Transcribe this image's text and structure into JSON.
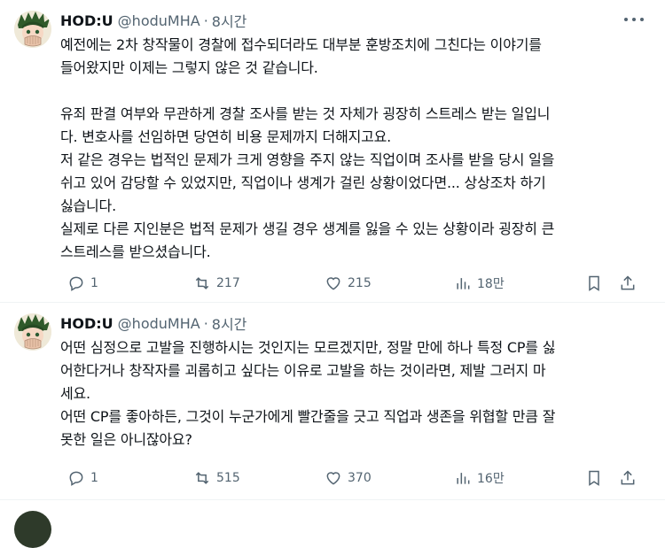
{
  "tweets": [
    {
      "name": "HOD:U",
      "handle": "@hoduMHA",
      "dot": "·",
      "time": "8시간",
      "lines": [
        "예전에는 2차 창작물이 경찰에 접수되더라도 대부분 훈방조치에 그친다는 이야기를",
        "들어왔지만 이제는 그렇지 않은 것 같습니다.",
        "",
        "유죄 판결 여부와 무관하게 경찰 조사를 받는 것 자체가 굉장히 스트레스 받는 일입니",
        "다. 변호사를 선임하면 당연히 비용 문제까지 더해지고요.",
        "저 같은 경우는 법적인 문제가 크게 영향을 주지 않는 직업이며 조사를 받을 당시 일을",
        "쉬고 있어 감당할 수 있었지만, 직업이나 생계가 걸린 상황이었다면... 상상조차 하기",
        "싫습니다.",
        "실제로 다른 지인분은 법적 문제가 생길 경우 생계를 잃을 수 있는 상황이라 굉장히 큰",
        "스트레스를 받으셨습니다."
      ],
      "replies": "1",
      "retweets": "217",
      "likes": "215",
      "views": "18만"
    },
    {
      "name": "HOD:U",
      "handle": "@hoduMHA",
      "dot": "·",
      "time": "8시간",
      "lines": [
        "어떤 심정으로 고발을 진행하시는 것인지는 모르겠지만, 정말 만에 하나 특정 CP를 싫",
        "어한다거나 창작자를 괴롭히고 싶다는 이유로 고발을 하는 것이라면, 제발 그러지 마",
        "세요.",
        "어떤 CP를 좋아하든, 그것이 누군가에게 빨간줄을 긋고 직업과 생존을 위협할 만큼 잘",
        "못한 일은 아니잖아요?"
      ],
      "replies": "1",
      "retweets": "515",
      "likes": "370",
      "views": "16만"
    }
  ]
}
